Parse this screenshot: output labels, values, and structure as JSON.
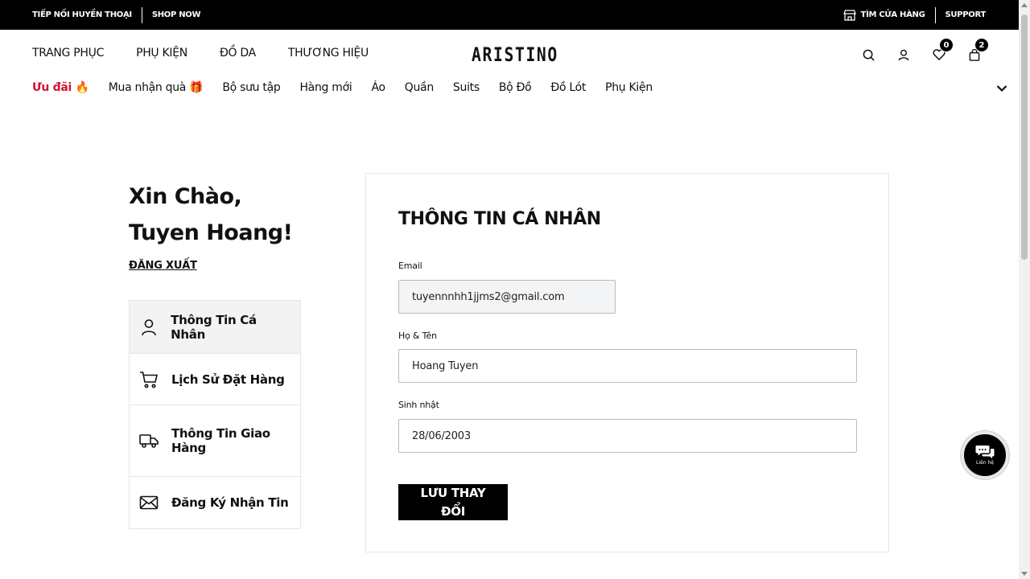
{
  "topbar": {
    "left_text": "TIẾP NỐI HUYỀN THOẠI",
    "shop_now": "SHOP NOW",
    "find_store": "TÌM CỬA HÀNG",
    "support": "SUPPORT"
  },
  "header": {
    "logo": "ARISTINO",
    "main_nav": [
      "TRANG PHỤC",
      "PHỤ KIỆN",
      "ĐỒ DA",
      "THƯƠNG HIỆU"
    ],
    "wishlist_count": "0",
    "cart_count": "2"
  },
  "subnav": {
    "items": [
      "Ưu đãi 🔥",
      "Mua nhận quà 🎁",
      "Bộ sưu tập",
      "Hàng mới",
      "Áo",
      "Quần",
      "Suits",
      "Bộ Đồ",
      "Đồ Lót",
      "Phụ Kiện"
    ]
  },
  "sidebar": {
    "greeting_line1": "Xin Chào,",
    "greeting_line2": "Tuyen Hoang!",
    "logout": "ĐĂNG XUẤT",
    "menu": [
      {
        "label": "Thông Tin Cá Nhân",
        "icon": "user-icon",
        "active": true
      },
      {
        "label": "Lịch Sử Đặt Hàng",
        "icon": "cart-icon",
        "active": false
      },
      {
        "label": "Thông Tin Giao Hàng",
        "icon": "truck-icon",
        "active": false
      },
      {
        "label": "Đăng Ký Nhận Tin",
        "icon": "mail-icon",
        "active": false
      }
    ]
  },
  "form": {
    "title": "THÔNG TIN CÁ NHÂN",
    "email_label": "Email",
    "email_value": "tuyennnhh1jjms2@gmail.com",
    "name_label": "Họ & Tên",
    "name_value": "Hoang Tuyen",
    "birthday_label": "Sinh nhật",
    "birthday_value": "28/06/2003",
    "save_button": "LƯU THAY ĐỔI"
  },
  "chat": {
    "label": "Liên hệ"
  },
  "colors": {
    "accent_red": "#d2122e",
    "primary_black": "#000000",
    "readonly_bg": "#f3f4f6"
  }
}
